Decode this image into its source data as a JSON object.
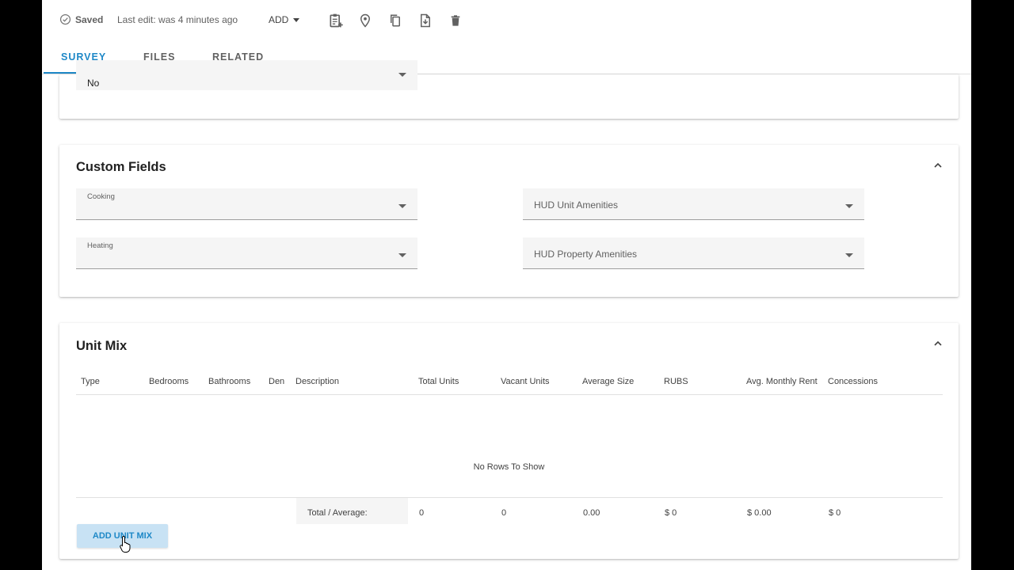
{
  "toolbar": {
    "saved_label": "Saved",
    "last_edit": "Last edit: was 4 minutes ago",
    "add_label": "ADD",
    "icons": [
      "clipboard-add-icon",
      "map-pin-icon",
      "copy-icon",
      "file-export-icon",
      "trash-icon"
    ]
  },
  "tabs": [
    {
      "label": "SURVEY",
      "active": true
    },
    {
      "label": "FILES",
      "active": false
    },
    {
      "label": "RELATED",
      "active": false
    }
  ],
  "top_card": {
    "select_value": "No"
  },
  "custom_fields": {
    "title": "Custom Fields",
    "fields": [
      {
        "label": "Cooking",
        "value": ""
      },
      {
        "placeholder": "HUD Unit Amenities"
      },
      {
        "label": "Heating",
        "value": ""
      },
      {
        "placeholder": "HUD Property Amenities"
      }
    ]
  },
  "unit_mix": {
    "title": "Unit Mix",
    "columns": [
      "Type",
      "Bedrooms",
      "Bathrooms",
      "Den",
      "Description",
      "Total Units",
      "Vacant Units",
      "Average Size",
      "RUBS",
      "Avg. Monthly Rent",
      "Concessions"
    ],
    "empty_message": "No Rows To Show",
    "footer": {
      "label": "Total / Average:",
      "total_units": "0",
      "vacant_units": "0",
      "average_size": "0.00",
      "rubs": "$ 0",
      "avg_monthly_rent": "$ 0.00",
      "concessions": "$ 0"
    },
    "add_button": "ADD UNIT MIX"
  },
  "colors": {
    "accent": "#1e88c7",
    "button_bg": "#c8e2f4"
  }
}
